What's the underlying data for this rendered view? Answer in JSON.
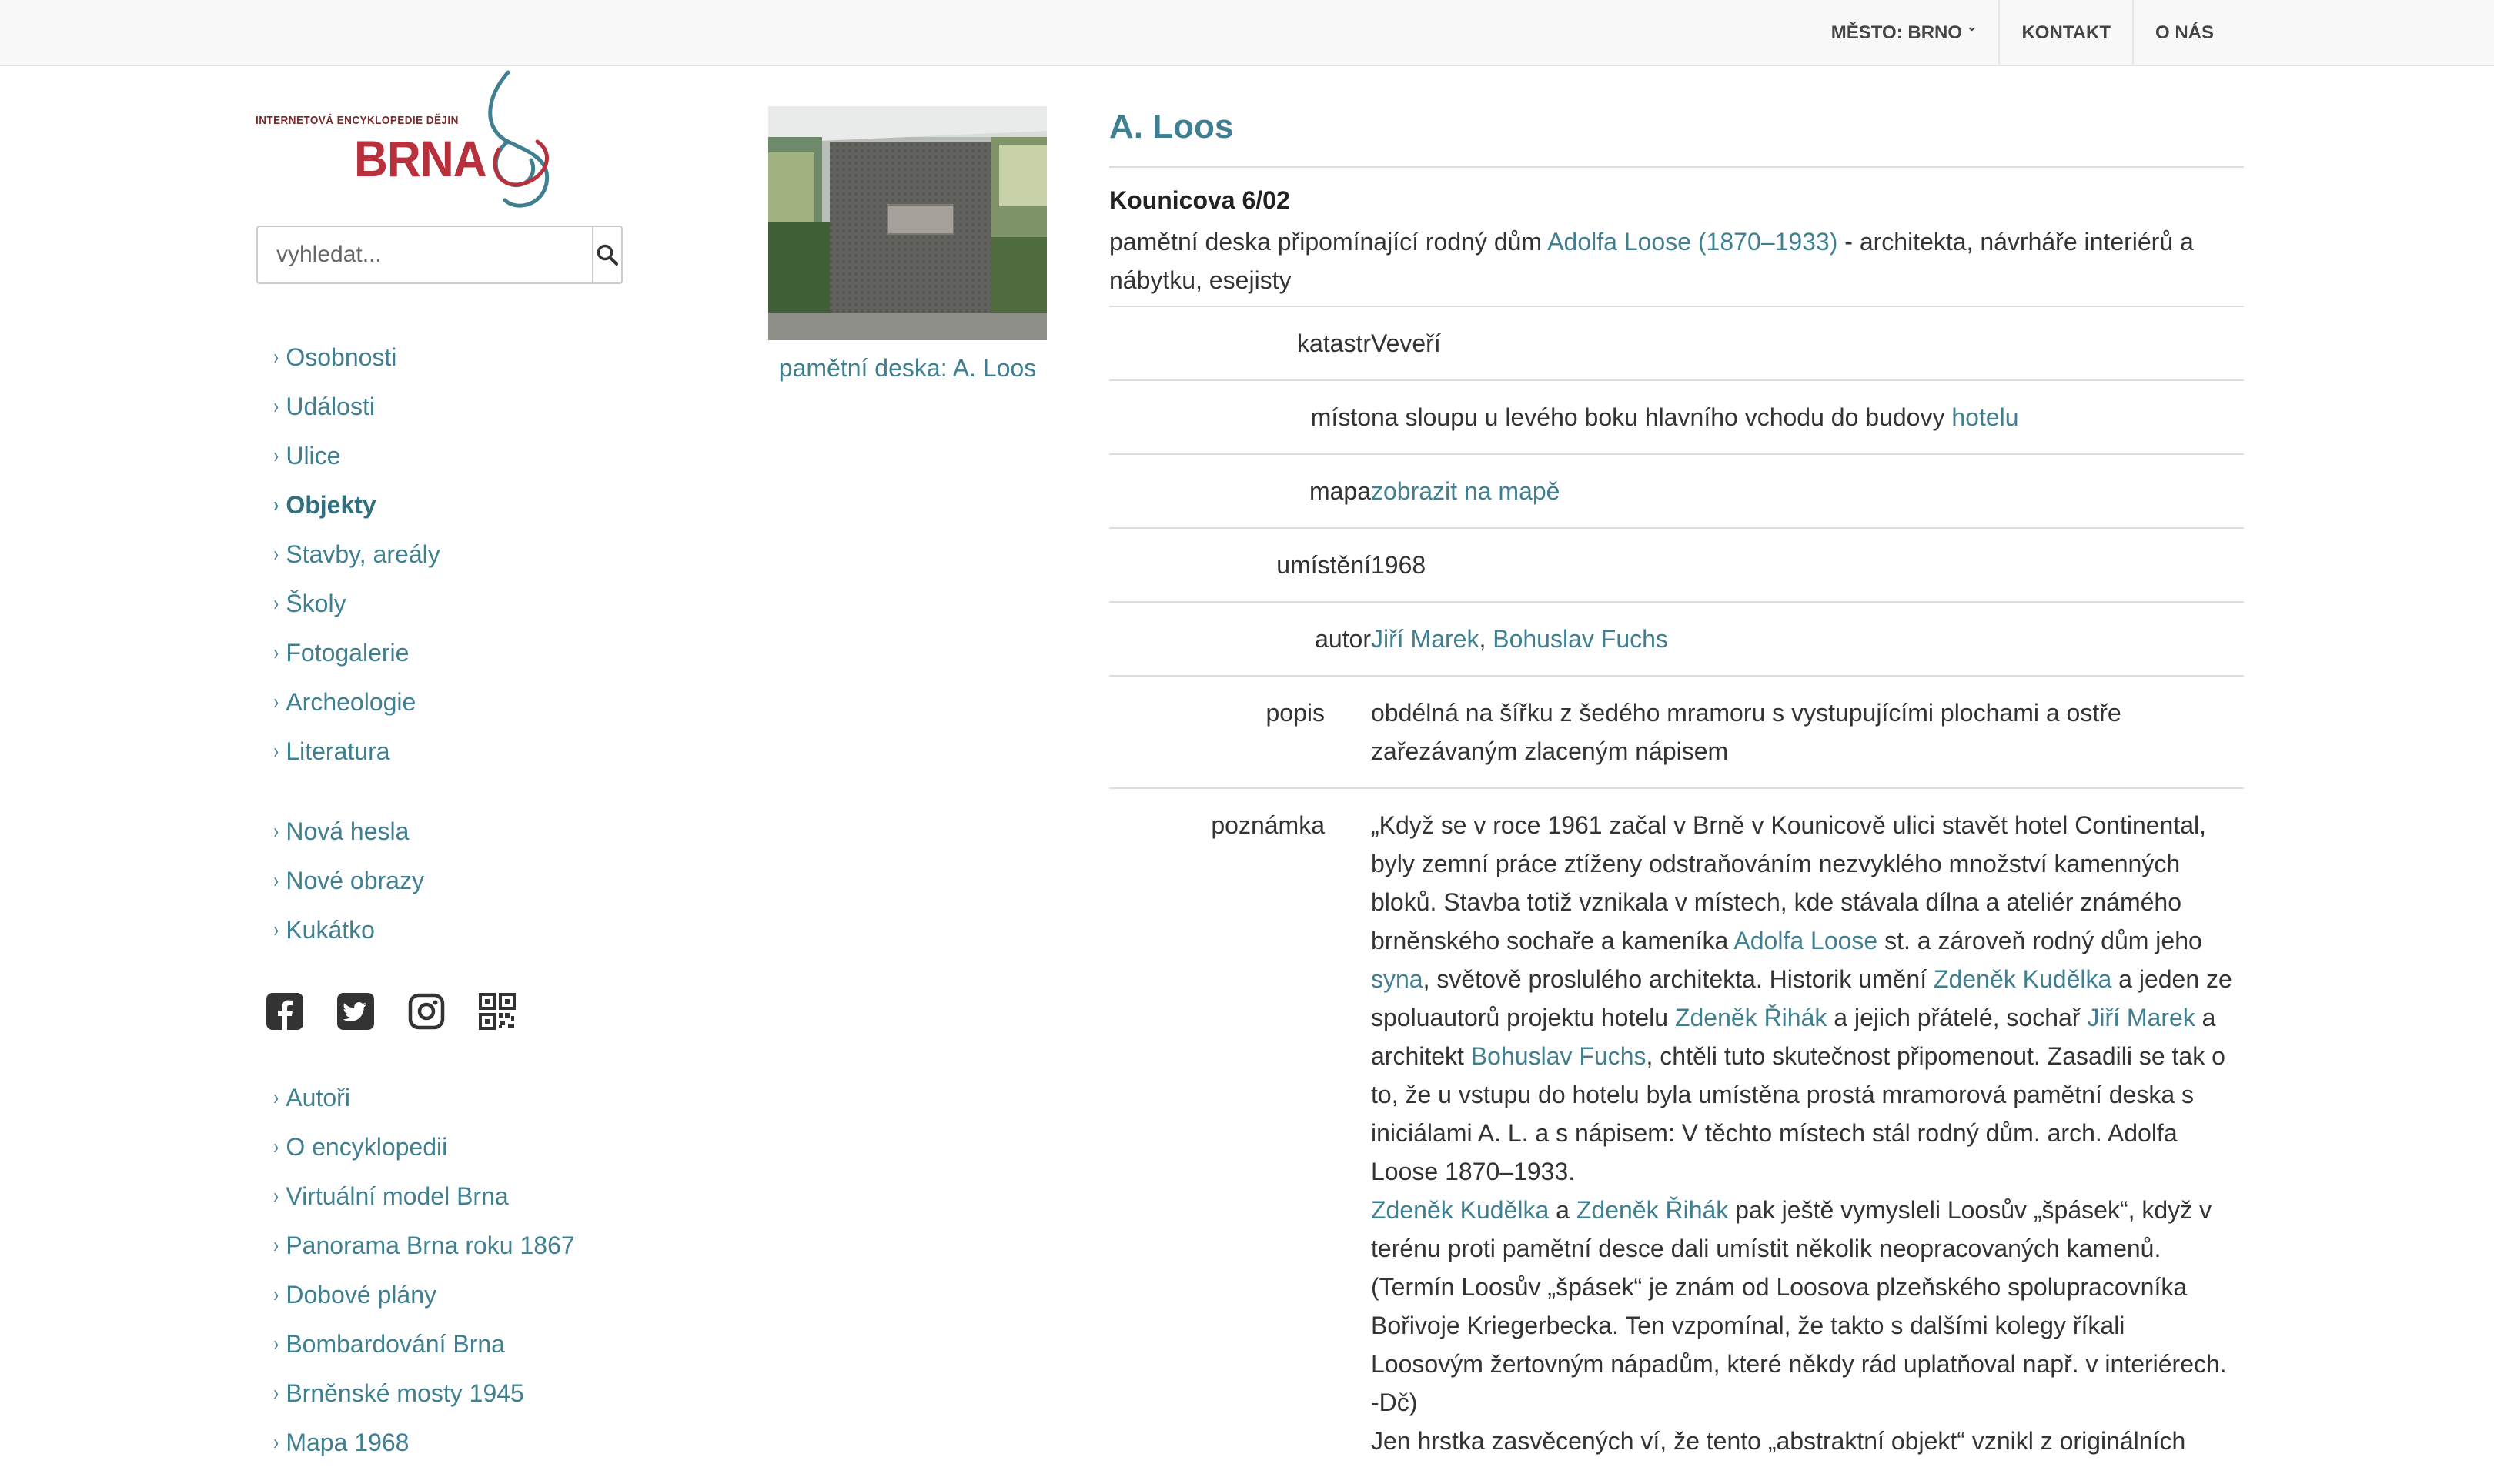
{
  "topnav": {
    "city": "MĚSTO: BRNO",
    "contact": "KONTAKT",
    "about": "O NÁS"
  },
  "logo": {
    "small_text": "INTERNETOVÁ ENCYKLOPEDIE DĚJIN",
    "big_text": "BRNA"
  },
  "search": {
    "placeholder": "vyhledat..."
  },
  "sidebar": {
    "group1": [
      "Osobnosti",
      "Události",
      "Ulice",
      "Objekty",
      "Stavby, areály",
      "Školy",
      "Fotogalerie",
      "Archeologie",
      "Literatura"
    ],
    "active": "Objekty",
    "group2": [
      "Nová hesla",
      "Nové obrazy",
      "Kukátko"
    ],
    "social_icons": [
      "facebook-icon",
      "twitter-icon",
      "instagram-icon",
      "qr-code-icon"
    ],
    "group3": [
      "Autoři",
      "O encyklopedii",
      "Virtuální model Brna",
      "Panorama Brna roku 1867",
      "Dobové plány",
      "Bombardování Brna",
      "Brněnské mosty 1945",
      "Mapa 1968"
    ]
  },
  "photo": {
    "caption": "pamětní deska: A. Loos"
  },
  "main": {
    "title": "A. Loos",
    "address": "Kounicova 6/02",
    "desc_before": "pamětní deska připomínající rodný dům ",
    "desc_link": "Adolfa Loose (1870–1933)",
    "desc_after": " - architekta, návrháře interiérů a nábytku, esejisty",
    "rows": {
      "katastr": {
        "label": "katastr",
        "value": "Veveří"
      },
      "misto": {
        "label": "místo",
        "value": "na sloupu u levého boku hlavního vchodu do budovy ",
        "link": "hotelu"
      },
      "mapa": {
        "label": "mapa",
        "link": "zobrazit na mapě"
      },
      "umisteni": {
        "label": "umístění",
        "value": "1968"
      },
      "autor": {
        "label": "autor",
        "link1": "Jiří Marek",
        "sep": ", ",
        "link2": "Bohuslav Fuchs"
      },
      "popis": {
        "label": "popis",
        "value": "obdélná na šířku z šedého mramoru s vystupujícími plochami a ostře zařezávaným zlaceným nápisem"
      },
      "poznamka": {
        "label": "poznámka",
        "p1": [
          {
            "t": "„Když se v roce 1961 začal v Brně v Kounicově ulici stavět hotel Continental, byly zemní práce ztíženy odstraňováním nezvyklého množství kamenných bloků. Stavba totiž vznikala v místech, kde stávala dílna a ateliér známého brněnského sochaře a kameníka "
          },
          {
            "l": "Adolfa Loose"
          },
          {
            "t": " st. a zároveň rodný dům jeho "
          },
          {
            "l": "syna"
          },
          {
            "t": ", světově proslulého architekta. Historik umění "
          },
          {
            "l": "Zdeněk Kudělka"
          },
          {
            "t": " a jeden ze spoluautorů projektu hotelu "
          },
          {
            "l": "Zdeněk Řihák"
          },
          {
            "t": " a jejich přátelé, sochař "
          },
          {
            "l": "Jiří Marek"
          },
          {
            "t": " a architekt "
          },
          {
            "l": "Bohuslav Fuchs"
          },
          {
            "t": ", chtěli tuto skutečnost připomenout. Zasadili se tak o to, že u vstupu do hotelu byla umístěna prostá mramorová pamětní deska s iniciálami A. L. a s nápisem: V těchto místech stál rodný dům. arch. Adolfa Loose 1870–1933."
          }
        ],
        "p2": [
          {
            "l": "Zdeněk Kudělka"
          },
          {
            "t": " a "
          },
          {
            "l": "Zdeněk Řihák"
          },
          {
            "t": " pak ještě vymysleli Loosův „špásek“, když v terénu proti pamětní desce dali umístit několik neopracovaných kamenů. (Termín Loosův „špásek“ je znám od Loosova plzeňského spolupracovníka Bořivoje Kriegerbecka. Ten vzpomínal, že takto s dalšími kolegy říkali Loosovým žertovným nápadům, které někdy rád uplatňoval např. v interiérech. -Dč)"
          }
        ],
        "p3": [
          {
            "t": "Jen hrstka zasvěcených ví, že tento „abstraktní objekt“ vznikl z originálních"
          }
        ]
      }
    }
  }
}
